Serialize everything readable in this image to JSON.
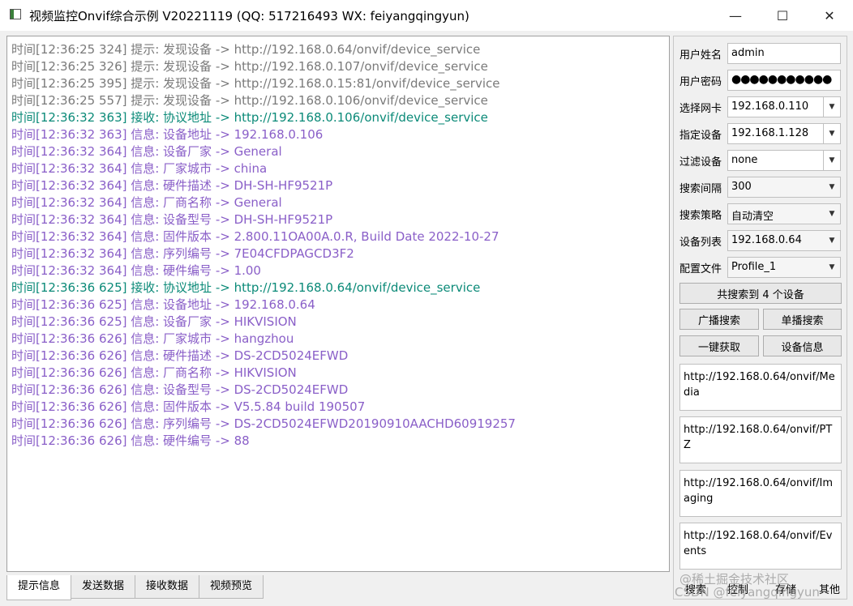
{
  "window": {
    "title": "视频监控Onvif综合示例 V20221119 (QQ: 517216493 WX: feiyangqingyun)",
    "min_glyph": "—",
    "max_glyph": "☐",
    "close_glyph": "✕"
  },
  "log": {
    "lines": [
      {
        "text": "时间[12:36:25 324] 提示: 发现设备 -> http://192.168.0.64/onvif/device_service",
        "kind": "hint"
      },
      {
        "text": "时间[12:36:25 326] 提示: 发现设备 -> http://192.168.0.107/onvif/device_service",
        "kind": "hint"
      },
      {
        "text": "时间[12:36:25 395] 提示: 发现设备 -> http://192.168.0.15:81/onvif/device_service",
        "kind": "hint"
      },
      {
        "text": "时间[12:36:25 557] 提示: 发现设备 -> http://192.168.0.106/onvif/device_service",
        "kind": "hint"
      },
      {
        "text": "时间[12:36:32 363] 接收: 协议地址 -> http://192.168.0.106/onvif/device_service",
        "kind": "recv"
      },
      {
        "text": "时间[12:36:32 363] 信息: 设备地址 -> 192.168.0.106",
        "kind": "info"
      },
      {
        "text": "时间[12:36:32 364] 信息: 设备厂家 -> General",
        "kind": "info"
      },
      {
        "text": "时间[12:36:32 364] 信息: 厂家城市 -> china",
        "kind": "info"
      },
      {
        "text": "时间[12:36:32 364] 信息: 硬件描述 -> DH-SH-HF9521P",
        "kind": "info"
      },
      {
        "text": "时间[12:36:32 364] 信息: 厂商名称 -> General",
        "kind": "info"
      },
      {
        "text": "时间[12:36:32 364] 信息: 设备型号 -> DH-SH-HF9521P",
        "kind": "info"
      },
      {
        "text": "时间[12:36:32 364] 信息: 固件版本 -> 2.800.11OA00A.0.R, Build Date 2022-10-27",
        "kind": "info"
      },
      {
        "text": "时间[12:36:32 364] 信息: 序列编号 -> 7E04CFDPAGCD3F2",
        "kind": "info"
      },
      {
        "text": "时间[12:36:32 364] 信息: 硬件编号 -> 1.00",
        "kind": "info"
      },
      {
        "text": "时间[12:36:36 625] 接收: 协议地址 -> http://192.168.0.64/onvif/device_service",
        "kind": "recv"
      },
      {
        "text": "时间[12:36:36 625] 信息: 设备地址 -> 192.168.0.64",
        "kind": "info"
      },
      {
        "text": "时间[12:36:36 625] 信息: 设备厂家 -> HIKVISION",
        "kind": "info"
      },
      {
        "text": "时间[12:36:36 626] 信息: 厂家城市 -> hangzhou",
        "kind": "info"
      },
      {
        "text": "时间[12:36:36 626] 信息: 硬件描述 -> DS-2CD5024EFWD",
        "kind": "info"
      },
      {
        "text": "时间[12:36:36 626] 信息: 厂商名称 -> HIKVISION",
        "kind": "info"
      },
      {
        "text": "时间[12:36:36 626] 信息: 设备型号 -> DS-2CD5024EFWD",
        "kind": "info"
      },
      {
        "text": "时间[12:36:36 626] 信息: 固件版本 -> V5.5.84 build 190507",
        "kind": "info"
      },
      {
        "text": "时间[12:36:36 626] 信息: 序列编号 -> DS-2CD5024EFWD20190910AACHD60919257",
        "kind": "info"
      },
      {
        "text": "时间[12:36:36 626] 信息: 硬件编号 -> 88",
        "kind": "info"
      }
    ]
  },
  "tabs": [
    "提示信息",
    "发送数据",
    "接收数据",
    "视频预览"
  ],
  "panel": {
    "username_label": "用户姓名",
    "username_value": "admin",
    "password_label": "用户密码",
    "password_value": "●●●●●●●●●●●",
    "nic_label": "选择网卡",
    "nic_value": "192.168.0.110",
    "device_label": "指定设备",
    "device_value": "192.168.1.128",
    "filter_label": "过滤设备",
    "filter_value": "none",
    "interval_label": "搜索间隔",
    "interval_value": "300",
    "strategy_label": "搜索策略",
    "strategy_value": "自动清空",
    "devlist_label": "设备列表",
    "devlist_value": "192.168.0.64",
    "profile_label": "配置文件",
    "profile_value": "Profile_1",
    "found_button": "共搜索到 4 个设备",
    "broadcast_button": "广播搜索",
    "unicast_button": "单播搜索",
    "onekey_button": "一键获取",
    "devinfo_button": "设备信息",
    "url_media": "http://192.168.0.64/onvif/Media",
    "url_ptz": "http://192.168.0.64/onvif/PTZ",
    "url_imaging": "http://192.168.0.64/onvif/Imaging",
    "url_events": "http://192.168.0.64/onvif/Events",
    "bottom_search": "搜索",
    "bottom_control": "控制",
    "bottom_storage": "存储",
    "bottom_other": "其他"
  },
  "watermark": {
    "line1": "@稀土掘金技术社区",
    "line2": "CSDN @feiyangqingyun"
  },
  "colors": {
    "hint": "#7a7a7a",
    "recv": "#0b8a78",
    "info": "#8a5fc8"
  }
}
